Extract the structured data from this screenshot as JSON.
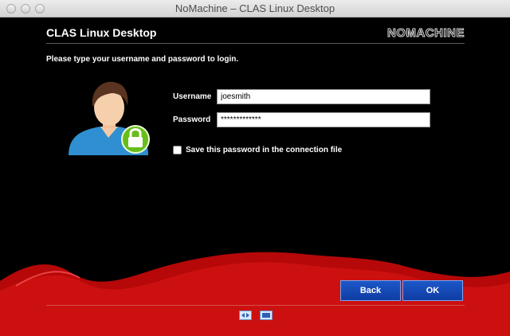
{
  "window": {
    "title": "NoMachine – CLAS Linux Desktop"
  },
  "header": {
    "title": "CLAS Linux Desktop",
    "brand": "NOMACHINE"
  },
  "login": {
    "instruction": "Please type your username and password to login.",
    "username_label": "Username",
    "username_value": "joesmith",
    "password_label": "Password",
    "password_value": "*************",
    "save_password_label": "Save this password in the connection file"
  },
  "buttons": {
    "back": "Back",
    "ok": "OK"
  },
  "icons": {
    "avatar": "user-avatar-icon",
    "lock": "lock-icon",
    "footer": [
      "fit-to-window-icon",
      "display-settings-icon"
    ]
  },
  "colors": {
    "background": "#000000",
    "wave": "#c40d0d",
    "button": "#1646b5",
    "lock_badge": "#6cbf1e"
  }
}
